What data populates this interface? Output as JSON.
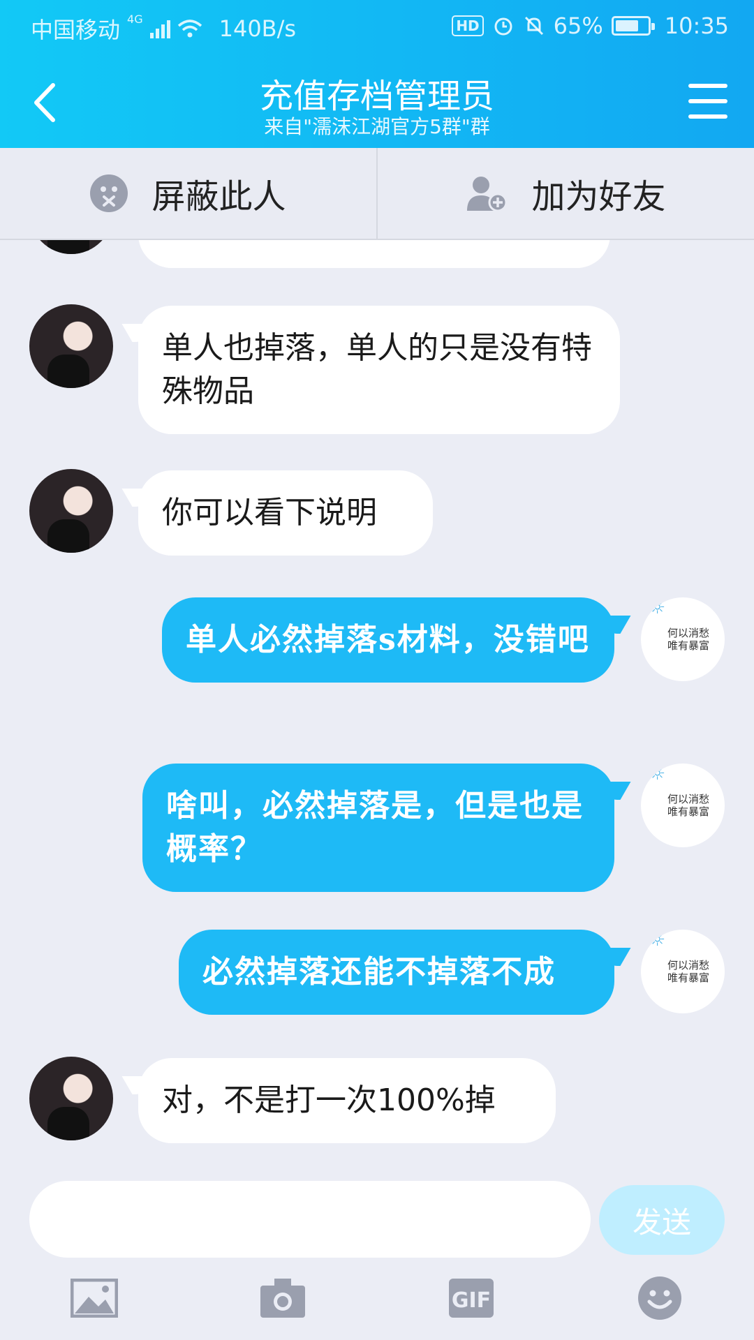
{
  "status_bar": {
    "carrier": "中国移动",
    "network": "4G",
    "speed": "140B/s",
    "hd": "HD",
    "battery": "65%",
    "time": "10:35"
  },
  "header": {
    "title": "充值存档管理员",
    "subtitle": "来自\"濡沫江湖官方5群\"群"
  },
  "actions": {
    "block_label": "屏蔽此人",
    "add_friend_label": "加为好友"
  },
  "messages": [
    {
      "side": "left",
      "text": "单人也掉落，单人的只是没有特殊物品"
    },
    {
      "side": "left",
      "text": "你可以看下说明"
    },
    {
      "side": "right",
      "text": "单人必然掉落s材料，没错吧"
    },
    {
      "side": "right",
      "text": "啥叫，必然掉落是，但是也是概率？"
    },
    {
      "side": "right",
      "text": "必然掉落还能不掉落不成"
    },
    {
      "side": "left",
      "text": "对，不是打一次100%掉"
    }
  ],
  "avatar_right_text": {
    "line1": "何以消愁",
    "line2": "唯有暴富"
  },
  "input": {
    "value": "",
    "send_label": "发送"
  },
  "colors": {
    "header": "#12b4f4",
    "bubble_right": "#1ebaf6",
    "bubble_left": "#ffffff",
    "send_disabled": "#bfeeff"
  }
}
